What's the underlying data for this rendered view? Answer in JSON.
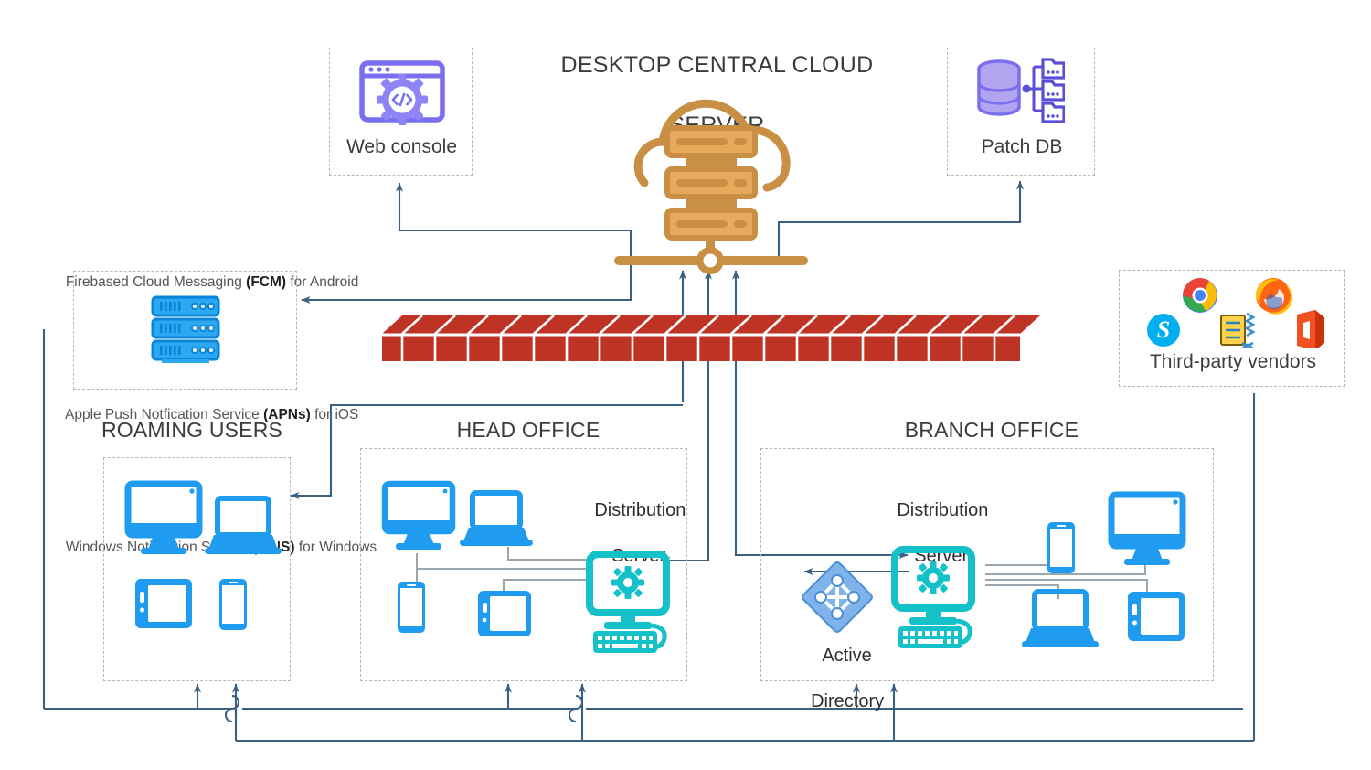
{
  "diagram": {
    "title_line1": "DESKTOP CENTRAL CLOUD",
    "title_line2": "SERVER",
    "colors": {
      "cloud_server": "#c98f45",
      "firewall": "#bf3324",
      "device_blue": "#1f9cf0",
      "distribution_server": "#15c1c8",
      "web_console_purple": "#7b6ef0",
      "patch_db_purple": "#8b7ae8",
      "connector": "#3a6184",
      "active_directory": "#7fb3ea",
      "dashed_border": "#b6b6b6"
    }
  },
  "notes": {
    "lines": [
      {
        "prefix": "Firebased Cloud Messaging ",
        "bold": "(FCM)",
        "suffix": " for Android"
      },
      {
        "prefix": "Apple Push Notfication Service ",
        "bold": "(APNs)",
        "suffix": " for iOS"
      },
      {
        "prefix": "Windows Notification Service ",
        "bold": "(WNS)",
        "suffix": " for Windows"
      }
    ]
  },
  "nodes": {
    "web_console": {
      "label": "Web console",
      "icon": "browser-gear-code-icon"
    },
    "patch_db": {
      "label": "Patch DB",
      "icon": "database-folders-icon"
    },
    "cloud_server": {
      "label": "",
      "icon": "cloud-server-racks-icon"
    },
    "notification_servers": {
      "label": "",
      "icon": "server-rack-stack-icon"
    },
    "third_party": {
      "label": "Third-party vendors",
      "icons": [
        "chrome-icon",
        "firefox-icon",
        "skype-icon",
        "winzip-icon",
        "office-icon"
      ]
    },
    "firewall": {
      "label": "",
      "icon": "brick-firewall-icon"
    },
    "active_directory": {
      "label_line1": "Active",
      "label_line2": "Directory",
      "icon": "active-directory-diamond-icon"
    }
  },
  "zones": [
    {
      "id": "roaming-users",
      "title": "ROAMING USERS",
      "devices": [
        "desktop-monitor-icon",
        "laptop-icon",
        "tablet-icon",
        "smartphone-icon"
      ]
    },
    {
      "id": "head-office",
      "title": "HEAD OFFICE",
      "server_label_line1": "Distribution",
      "server_label_line2": "Server",
      "devices": [
        "desktop-monitor-icon",
        "laptop-icon",
        "smartphone-icon",
        "tablet-icon"
      ]
    },
    {
      "id": "branch-office",
      "title": "BRANCH OFFICE",
      "server_label_line1": "Distribution",
      "server_label_line2": "Server",
      "devices": [
        "smartphone-icon",
        "desktop-monitor-icon",
        "laptop-icon",
        "tablet-icon"
      ]
    }
  ]
}
